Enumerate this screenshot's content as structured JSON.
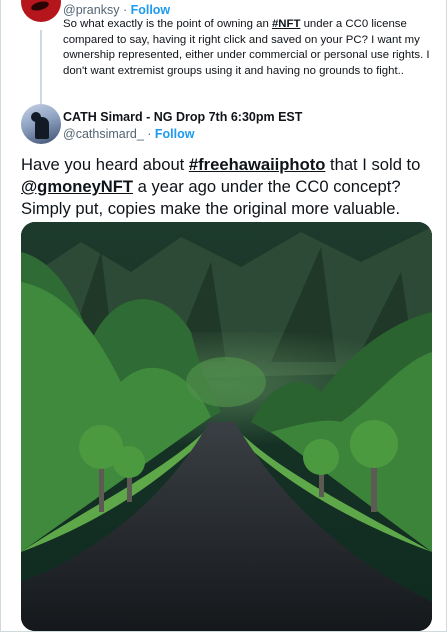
{
  "quoted_tweet": {
    "handle": "@pranksy",
    "separator": " · ",
    "follow_label": "Follow",
    "text_before": "So what exactly is the point of owning an ",
    "hashtag": "#NFT",
    "text_after": " under a CC0 license compared to say, having it right click and saved on your PC? I want my ownership represented, either under commercial or personal use rights. I don't want extremist groups using it and having no grounds to fight.."
  },
  "tweet": {
    "display_name": "CATH Simard - NG Drop 7th 6:30pm EST",
    "handle": "@cathsimard_",
    "separator": " · ",
    "follow_label": "Follow",
    "text_1": "Have you heard about ",
    "hashtag": "#freehawaiiphoto",
    "text_2": " that I sold to ",
    "mention": "@gmoneyNFT",
    "text_3": " a year ago under the CC0 concept? Simply put, copies make the original more valuable."
  },
  "colors": {
    "link": "#1d9bf0",
    "secondary_text": "#536471",
    "primary_text": "#0f1419"
  },
  "media": {
    "icon": "photo-icon"
  }
}
